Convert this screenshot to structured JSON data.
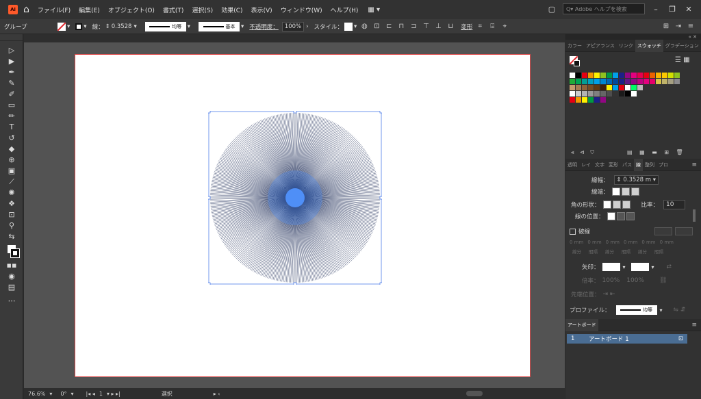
{
  "app": {
    "logo": "Ai",
    "home_icon": "home-icon"
  },
  "menu": [
    "ファイル(F)",
    "編集(E)",
    "オブジェクト(O)",
    "書式(T)",
    "選択(S)",
    "効果(C)",
    "表示(V)",
    "ウィンドウ(W)",
    "ヘルプ(H)"
  ],
  "workspace_icon": "▦ ▾",
  "search_placeholder": "Q▾ Adobe ヘルプを検索",
  "control": {
    "selection_type": "グループ",
    "stroke_label": "線：",
    "stroke_value": "0.3528",
    "profile_label": "均等",
    "brush_label": "基本",
    "opacity_label": "不透明度：",
    "opacity_value": "100%",
    "style_label": "スタイル：",
    "transform_label": "変形"
  },
  "status": {
    "zoom": "76.6%",
    "rotation": "0°",
    "artboard_num": "1",
    "mode": "選択"
  },
  "panels": {
    "top_tabs": [
      "カラー",
      "アピアランス",
      "リンク",
      "スウォッチ",
      "グラデーション"
    ],
    "top_active": "スウォッチ",
    "stroke_tabs": [
      "透明",
      "レイ",
      "文字",
      "変形",
      "パス",
      "線",
      "整列",
      "プロ"
    ],
    "stroke_active": "線",
    "weight_label": "線幅：",
    "weight_value": "0.3528 m",
    "cap_label": "線端：",
    "corner_label": "角の形状：",
    "limit_label": "比率：",
    "limit_value": "10",
    "align_label": "線の位置：",
    "dash_label": "破線",
    "dash_units": [
      "0 mm",
      "0 mm",
      "0 mm",
      "0 mm",
      "0 mm",
      "0 mm"
    ],
    "dash_sub": [
      "線分",
      "間隔",
      "線分",
      "間隔",
      "線分",
      "間隔"
    ],
    "arrow_label": "矢印：",
    "scale_label": "倍率：",
    "scale_value1": "100%",
    "scale_value2": "100%",
    "arrow_align_label": "先端位置：",
    "profile_label": "プロファイル：",
    "profile_value": "均等",
    "artboards_tab": "アートボード",
    "artboard_row_num": "1",
    "artboard_row_name": "アートボード 1"
  },
  "colors": {
    "menubar": "#323232",
    "panel": "#323232",
    "canvas": "#535353",
    "artboard_border": "#e04848",
    "burst_line": "#1c2a56",
    "burst_core": "#4f8ff7",
    "selection": "#4f7ee8",
    "active_row": "#4a6d93"
  },
  "swatches": [
    [
      "#ffffff",
      "#000000",
      "#e60012",
      "#f39800",
      "#fff100",
      "#8fc31f",
      "#009944",
      "#00a0e9",
      "#1d2088",
      "#920783",
      "#e4007f",
      "#e5004f",
      "#e60012",
      "#eb6100",
      "#f8b500",
      "#fcc800",
      "#d1e000",
      "#8fc31f"
    ],
    [
      "#22ac38",
      "#00a653",
      "#009e96",
      "#00a0c1",
      "#00a0e9",
      "#0086d1",
      "#0068b7",
      "#00479d",
      "#1d2088",
      "#601986",
      "#920783",
      "#be0081",
      "#e4007f",
      "#e5006a",
      "#d7c447",
      "#c0b36a",
      "#a59f82",
      "#8b8a8d"
    ],
    [
      "#c69c6d",
      "#a67c52",
      "#8c6239",
      "#754c24",
      "#603913",
      "#42210b",
      "#fff100",
      "#00a0e9",
      "#e60012",
      "#ffffff",
      "#00ff66",
      "#bbbbbb"
    ],
    [
      "#ffffff",
      "#cccccc",
      "#b3b3b3",
      "#999999",
      "#808080",
      "#666666",
      "#4d4d4d",
      "#333333",
      "#1a1a1a",
      "#000000",
      "#ffffff"
    ],
    [
      "#e60012",
      "#f39800",
      "#fff100",
      "#009944",
      "#1d2088",
      "#920783"
    ]
  ]
}
